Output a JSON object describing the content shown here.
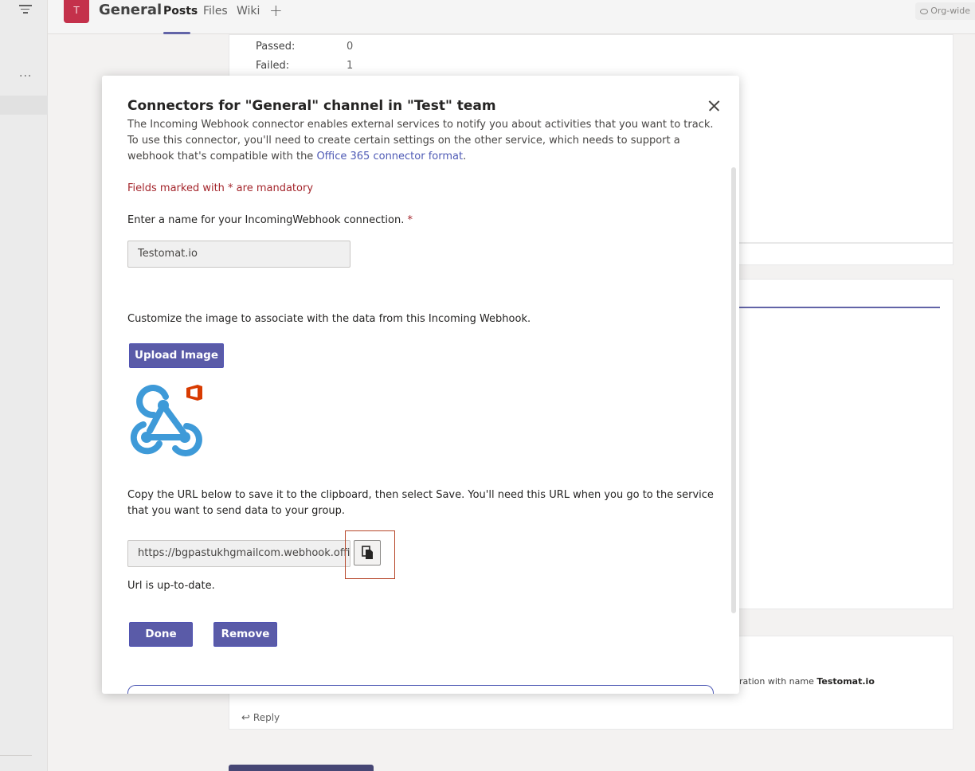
{
  "header": {
    "team_initial": "T",
    "channel_name": "General",
    "tabs": [
      {
        "label": "Posts"
      },
      {
        "label": "Files"
      },
      {
        "label": "Wiki"
      }
    ],
    "add_tab": "+",
    "org_badge": "Org-wide"
  },
  "rail": {
    "more": "···"
  },
  "background_post": {
    "rows": [
      {
        "label": "Passed:",
        "value": "0"
      },
      {
        "label": "Failed:",
        "value": "1"
      }
    ],
    "snippet_prefix": "ration with name ",
    "snippet_bold": "Testomat.io",
    "reply_label": "Reply"
  },
  "modal": {
    "title": "Connectors for \"General\" channel in \"Test\" team",
    "description_before_link": "The Incoming Webhook connector enables external services to notify you about activities that you want to track. To use this connector, you'll need to create certain settings on the other service, which needs to support a webhook that's compatible with the ",
    "description_link": "Office 365 connector format",
    "description_after_link": ".",
    "mandatory_note": "Fields marked with * are mandatory",
    "name_label": "Enter a name for your IncomingWebhook connection.",
    "required_star": "*",
    "name_value": "Testomat.io",
    "image_label": "Customize the image to associate with the data from this Incoming Webhook.",
    "upload_button": "Upload Image",
    "logo_icon": "webhook-office-icon",
    "url_label": "Copy the URL below to save it to the clipboard, then select Save. You'll need this URL when you go to the service that you want to send data to your group.",
    "url_value": "https://bgpastukhgmailcom.webhook.offi",
    "copy_icon": "copy-icon",
    "url_status": "Url is up-to-date.",
    "done_button": "Done",
    "remove_button": "Remove"
  },
  "colors": {
    "accent": "#5a5ba8",
    "mandatory_red": "#a4262c",
    "link_blue": "#4e5ab5",
    "highlight": "#b7472a",
    "logo_blue": "#3e9ad8",
    "office_orange": "#d83b01"
  }
}
